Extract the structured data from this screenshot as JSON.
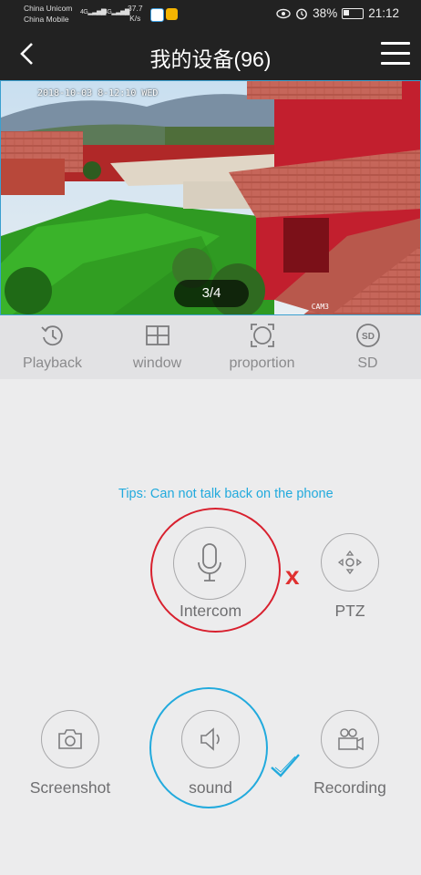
{
  "status_bar": {
    "carrier1": "China Unicom",
    "carrier2": "China Mobile",
    "network1": "4G",
    "network2": "4G",
    "speed_value": "37.7",
    "speed_unit": "K/s",
    "battery": "38%",
    "time": "21:12"
  },
  "header": {
    "title": "我的设备(96)"
  },
  "video": {
    "timestamp": "2018-10-03 8-12:10 WED",
    "camera_label": "CAM3",
    "page_indicator": "3/4"
  },
  "toolbar": {
    "playback": "Playback",
    "window": "window",
    "proportion": "proportion",
    "sd_icon_text": "SD",
    "sd": "SD"
  },
  "controls": {
    "tips": "Tips: Can not talk back on the phone",
    "intercom": "Intercom",
    "ptz": "PTZ",
    "screenshot": "Screenshot",
    "sound": "sound",
    "recording": "Recording",
    "annotation_x": "x"
  },
  "colors": {
    "accent_blue": "#22aadd",
    "warning_red": "#d8202e",
    "header_bg": "#222222"
  }
}
